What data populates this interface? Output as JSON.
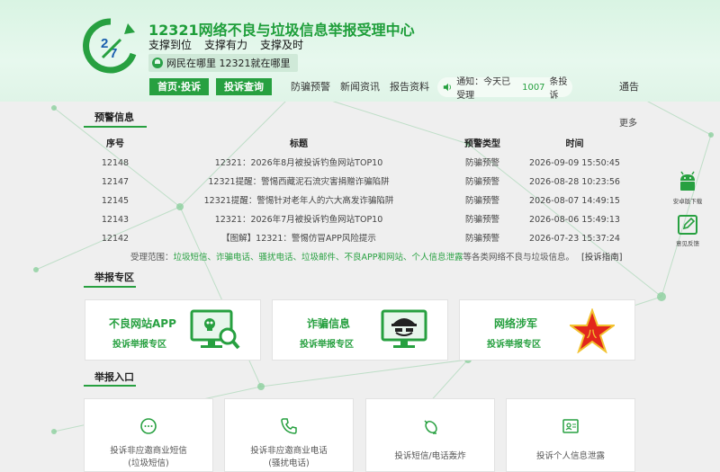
{
  "header": {
    "site_title": "12321网络不良与垃圾信息举报受理中心",
    "slogans": [
      "支撑到位",
      "支撑有力",
      "支撑及时"
    ],
    "motto": "网民在哪里 12321就在哪里"
  },
  "nav": {
    "home": "首页·投诉",
    "query": "投诉查询",
    "links": [
      "防骗预警",
      "新闻资讯",
      "报告资料"
    ],
    "notice_prefix": "通知：今天已受理",
    "notice_count": "1007",
    "notice_suffix": "条投诉",
    "announce": "通告"
  },
  "warning": {
    "title": "预警信息",
    "more": "更多",
    "columns": [
      "序号",
      "标题",
      "预警类型",
      "时间"
    ],
    "rows": [
      {
        "id": "12148",
        "title": "12321：2026年8月被投诉钓鱼网站TOP10",
        "type": "防骗预警",
        "time": "2026-09-09 15:50:45"
      },
      {
        "id": "12147",
        "title": "12321提醒：警惕西藏泥石流灾害捐赠诈骗陷阱",
        "type": "防骗预警",
        "time": "2026-08-28 10:23:56"
      },
      {
        "id": "12145",
        "title": "12321提醒：警惕针对老年人的六大高发诈骗陷阱",
        "type": "防骗预警",
        "time": "2026-08-07 14:49:15"
      },
      {
        "id": "12143",
        "title": "12321：2026年7月被投诉钓鱼网站TOP10",
        "type": "防骗预警",
        "time": "2026-08-06 15:49:13"
      },
      {
        "id": "12142",
        "title": "【图解】12321：警惕仿冒APP风险提示",
        "type": "防骗预警",
        "time": "2026-07-23 15:37:24"
      }
    ]
  },
  "scope": {
    "prefix": "受理范围：",
    "items": "垃圾短信、诈骗电话、骚扰电话、垃圾邮件、不良APP和网站、个人信息泄露",
    "suffix": "等各类网络不良与垃圾信息。",
    "guide": "[投诉指南]"
  },
  "report_zone": {
    "title": "举报专区",
    "cards": [
      {
        "title": "不良网站APP",
        "sub": "投诉举报专区",
        "icon": "monitor-skull-search-icon"
      },
      {
        "title": "诈骗信息",
        "sub": "投诉举报专区",
        "icon": "monitor-spy-icon"
      },
      {
        "title": "网络涉军",
        "sub": "投诉举报专区",
        "icon": "army-star-icon"
      }
    ]
  },
  "entry_zone": {
    "title": "举报入口",
    "items": [
      {
        "line1": "投诉非应邀商业短信",
        "line2": "(垃圾短信)",
        "icon": "chat-bubble-icon"
      },
      {
        "line1": "投诉非应邀商业电话",
        "line2": "(骚扰电话)",
        "icon": "phone-icon"
      },
      {
        "line1": "投诉短信/电话轰炸",
        "line2": "",
        "icon": "bomb-icon"
      },
      {
        "line1": "投诉个人信息泄露",
        "line2": "",
        "icon": "id-card-icon"
      }
    ]
  },
  "float": {
    "android": "安卓版下载",
    "feedback": "意见反馈"
  },
  "colors": {
    "accent": "#27a040",
    "header_bg": "#dff4e7",
    "page_bg": "#efefef"
  }
}
